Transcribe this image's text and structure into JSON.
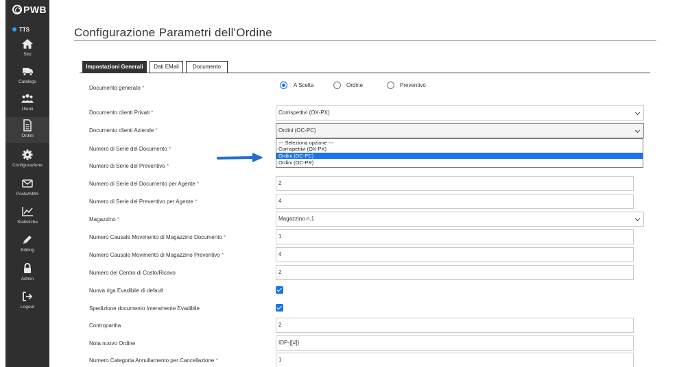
{
  "brand": {
    "name": "PWB",
    "status": "TTS",
    "status_color": "#1fa3ff"
  },
  "sidebar": {
    "items": [
      {
        "label": "Sito",
        "icon": "home-icon"
      },
      {
        "label": "Catalogo",
        "icon": "truck-icon"
      },
      {
        "label": "Utenti",
        "icon": "users-icon"
      },
      {
        "label": "Ordini",
        "icon": "document-icon",
        "active": true
      },
      {
        "label": "Configurazione",
        "icon": "gear-icon"
      },
      {
        "label": "Posta/SMS",
        "icon": "envelope-icon"
      },
      {
        "label": "Statistiche",
        "icon": "chart-icon"
      },
      {
        "label": "Editing",
        "icon": "pencil-icon"
      },
      {
        "label": "Admin",
        "icon": "lock-icon"
      },
      {
        "label": "Logout",
        "icon": "logout-icon"
      }
    ]
  },
  "page": {
    "title": "Configurazione Parametri dell'Ordine"
  },
  "tabs": [
    {
      "label": "Impostazioni Generali",
      "active": true
    },
    {
      "label": "Dati EMail",
      "active": false
    },
    {
      "label": "Documento",
      "active": false
    }
  ],
  "form": {
    "required_mark": "*",
    "documento_generato": {
      "label": "Documento generato",
      "options": [
        {
          "label": "A Scelta",
          "checked": true
        },
        {
          "label": "Ordine",
          "checked": false
        },
        {
          "label": "Preventivo",
          "checked": false
        }
      ]
    },
    "clienti_privati": {
      "label": "Documento clienti Privati",
      "value": "Corrispettivi (OX-PX)"
    },
    "clienti_aziende": {
      "label": "Documento clienti Aziende",
      "value": "Ordini (OC-PC)"
    },
    "aziende_dropdown": {
      "options": [
        "--- Seleziona opzione ---",
        "Corrispettivi (OX-PX)",
        "Ordini (OC-PC)",
        "Ordini (OC-PR)"
      ],
      "highlighted": "Ordini (OC-PC)"
    },
    "serie_documento": {
      "label": "Numero di Serie del Documento"
    },
    "serie_preventivo": {
      "label": "Numero di Serie del Preventivo"
    },
    "serie_doc_agente": {
      "label": "Numero di Serie del Documento per Agente",
      "value": "2"
    },
    "serie_prev_agente": {
      "label": "Numero di Serie del Preventivo per Agente",
      "value": "4"
    },
    "magazzino": {
      "label": "Magazzino",
      "value": "Magazzino n.1"
    },
    "causale_doc": {
      "label": "Numero Causale Movimento di Magazzino Documento",
      "value": "1"
    },
    "causale_prev": {
      "label": "Numero Causale Movimento di Magazzino Preventivo",
      "value": "4"
    },
    "centro_costo": {
      "label": "Numero del Centro di Costo/Ricavo",
      "value": "2"
    },
    "nuova_riga": {
      "label": "Nuova riga Evadibile di default",
      "checked": true
    },
    "spedizione": {
      "label": "Spedizione documento Interamente Evadibile",
      "checked": true
    },
    "contropartita": {
      "label": "Contropartita",
      "value": "2"
    },
    "nota_ordine": {
      "label": "Nota nuovo Ordine",
      "value": "IDP-{[#]}"
    },
    "categoria_annullamento": {
      "label": "Numero Categoria Annullamento per Cancellazione",
      "value": "1"
    }
  },
  "colors": {
    "accent": "#1a73e8",
    "sidebar": "#2f2f2f",
    "required": "#e05050"
  }
}
